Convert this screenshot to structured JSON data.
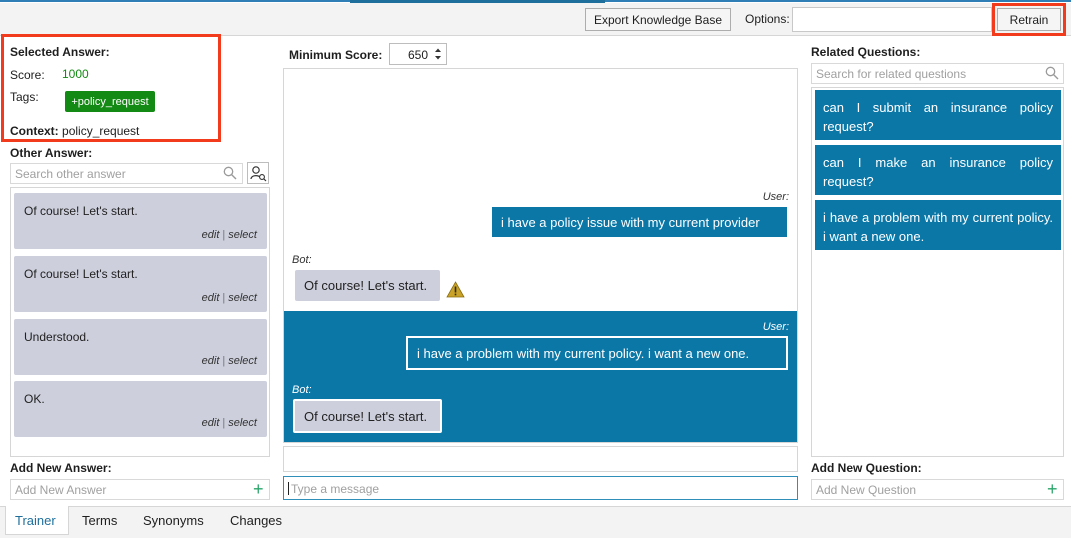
{
  "toolbar": {
    "export_label": "Export Knowledge Base",
    "options_label": "Options:",
    "options_value": "",
    "retrain_label": "Retrain"
  },
  "selected": {
    "heading": "Selected Answer:",
    "score_label": "Score:",
    "score_value": "1000",
    "tags_label": "Tags:",
    "tag": "+policy_request",
    "context_label": "Context:",
    "context_value": "policy_request"
  },
  "other": {
    "heading": "Other Answer:",
    "search_placeholder": "Search other answer",
    "items": [
      {
        "text": "Of course! Let's start.",
        "edit": "edit",
        "sep": "|",
        "select": "select"
      },
      {
        "text": "Of course! Let's start.",
        "edit": "edit",
        "sep": "|",
        "select": "select"
      },
      {
        "text": "Understood.",
        "edit": "edit",
        "sep": "|",
        "select": "select"
      },
      {
        "text": "OK.",
        "edit": "edit",
        "sep": "|",
        "select": "select"
      }
    ],
    "add_heading": "Add New Answer:",
    "add_placeholder": "Add New Answer"
  },
  "center": {
    "min_score_label": "Minimum Score:",
    "min_score_value": "650",
    "messages": [
      {
        "who": "User:",
        "text": "i have a policy issue with my current provider"
      },
      {
        "who": "Bot:",
        "text": "Of course! Let's start."
      },
      {
        "who": "User:",
        "text": "i have a problem with my current policy.  i want a new one."
      },
      {
        "who": "Bot:",
        "text": "Of course! Let's start."
      }
    ],
    "message_placeholder": "Type a message"
  },
  "related": {
    "heading": "Related Questions:",
    "search_placeholder": "Search for related questions",
    "items": [
      "can I submit an insurance policy request?",
      "can I make an insurance policy request?",
      "i have a problem with my current policy.  i want a new one."
    ],
    "add_heading": "Add New Question:",
    "add_placeholder": "Add New Question"
  },
  "tabs": [
    "Trainer",
    "Terms",
    "Synonyms",
    "Changes"
  ],
  "colors": {
    "accent": "#0b77a7",
    "tag": "#138a13",
    "highlight": "#f23a1c",
    "card": "#cdcfdc"
  }
}
